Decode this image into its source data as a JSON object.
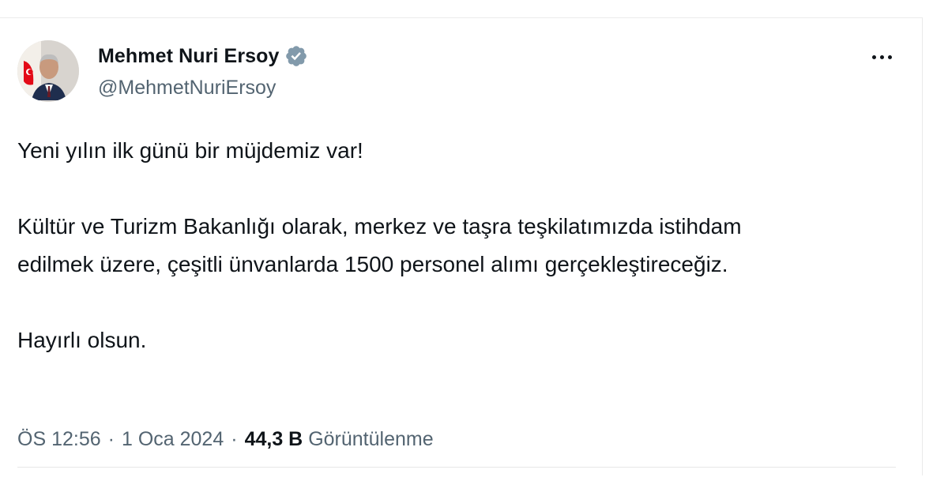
{
  "author": {
    "display_name": "Mehmet Nuri Ersoy",
    "handle": "@MehmetNuriErsoy",
    "verified": true
  },
  "icons": {
    "verified": "verified-badge-icon",
    "more": "more-horizontal-icon"
  },
  "colors": {
    "text_primary": "#0f1419",
    "text_secondary": "#536471",
    "verified_badge": "#829aab"
  },
  "tweet": {
    "paragraphs": [
      "Yeni yılın ilk günü bir müjdemiz var!",
      "Kültür ve Turizm Bakanlığı olarak, merkez ve taşra teşkilatımızda istihdam edilmek üzere, çeşitli ünvanlarda 1500 personel alımı gerçekleştireceğiz.",
      "Hayırlı olsun."
    ]
  },
  "meta": {
    "time": "ÖS 12:56",
    "date": "1 Oca 2024",
    "views_count": "44,3 B",
    "views_label": "Görüntülenme",
    "separator": "·"
  }
}
